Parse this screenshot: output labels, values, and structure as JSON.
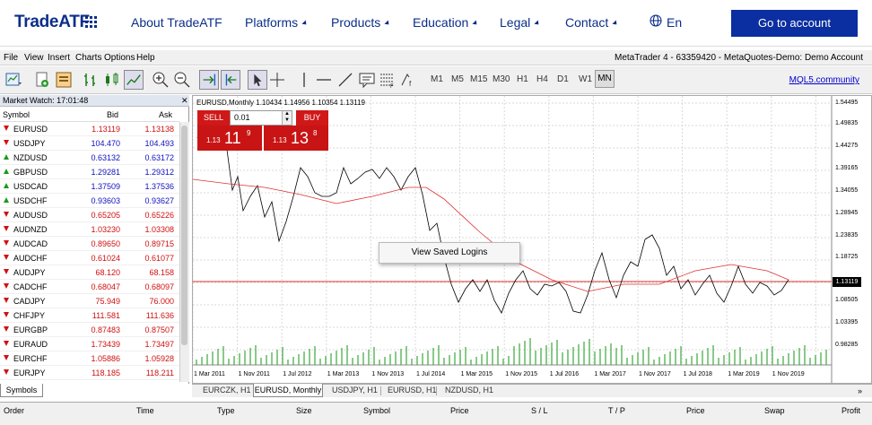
{
  "nav": {
    "logo": "TradeATF",
    "items": [
      {
        "label": "About TradeATF",
        "caret": false
      },
      {
        "label": "Platforms",
        "caret": true
      },
      {
        "label": "Products",
        "caret": true
      },
      {
        "label": "Education",
        "caret": true
      },
      {
        "label": "Legal",
        "caret": true
      },
      {
        "label": "Contact",
        "caret": true
      }
    ],
    "lang": "En",
    "cta": "Go to account"
  },
  "menubar": {
    "items": [
      "File",
      "View",
      "Insert",
      "Charts",
      "Options",
      "Help"
    ],
    "title": "MetaTrader 4 - 63359420 - MetaQuotes-Demo: Demo Account"
  },
  "toolbar": {
    "timeframes": [
      "M1",
      "M5",
      "M15",
      "M30",
      "H1",
      "H4",
      "D1",
      "W1",
      "MN"
    ],
    "community_link": "MQL5.community"
  },
  "market_watch": {
    "title": "Market Watch: 17:01:48",
    "columns": [
      "Symbol",
      "Bid",
      "Ask"
    ],
    "rows": [
      {
        "symbol": "EURUSD",
        "bid": "1.13119",
        "ask": "1.13138",
        "dir": "down",
        "color": "red"
      },
      {
        "symbol": "USDJPY",
        "bid": "104.470",
        "ask": "104.493",
        "dir": "down",
        "color": "blue"
      },
      {
        "symbol": "NZDUSD",
        "bid": "0.63132",
        "ask": "0.63172",
        "dir": "up",
        "color": "blue"
      },
      {
        "symbol": "GBPUSD",
        "bid": "1.29281",
        "ask": "1.29312",
        "dir": "up",
        "color": "blue"
      },
      {
        "symbol": "USDCAD",
        "bid": "1.37509",
        "ask": "1.37536",
        "dir": "up",
        "color": "blue"
      },
      {
        "symbol": "USDCHF",
        "bid": "0.93603",
        "ask": "0.93627",
        "dir": "up",
        "color": "blue"
      },
      {
        "symbol": "AUDUSD",
        "bid": "0.65205",
        "ask": "0.65226",
        "dir": "down",
        "color": "red"
      },
      {
        "symbol": "AUDNZD",
        "bid": "1.03230",
        "ask": "1.03308",
        "dir": "down",
        "color": "red"
      },
      {
        "symbol": "AUDCAD",
        "bid": "0.89650",
        "ask": "0.89715",
        "dir": "down",
        "color": "red"
      },
      {
        "symbol": "AUDCHF",
        "bid": "0.61024",
        "ask": "0.61077",
        "dir": "down",
        "color": "red"
      },
      {
        "symbol": "AUDJPY",
        "bid": "68.120",
        "ask": "68.158",
        "dir": "down",
        "color": "red"
      },
      {
        "symbol": "CADCHF",
        "bid": "0.68047",
        "ask": "0.68097",
        "dir": "down",
        "color": "red"
      },
      {
        "symbol": "CADJPY",
        "bid": "75.949",
        "ask": "76.000",
        "dir": "down",
        "color": "red"
      },
      {
        "symbol": "CHFJPY",
        "bid": "111.581",
        "ask": "111.636",
        "dir": "down",
        "color": "red"
      },
      {
        "symbol": "EURGBP",
        "bid": "0.87483",
        "ask": "0.87507",
        "dir": "down",
        "color": "red"
      },
      {
        "symbol": "EURAUD",
        "bid": "1.73439",
        "ask": "1.73497",
        "dir": "down",
        "color": "red"
      },
      {
        "symbol": "EURCHF",
        "bid": "1.05886",
        "ask": "1.05928",
        "dir": "down",
        "color": "red"
      },
      {
        "symbol": "EURJPY",
        "bid": "118.185",
        "ask": "118.211",
        "dir": "down",
        "color": "red"
      }
    ],
    "tab": "Symbols"
  },
  "chart": {
    "info": "EURUSD,Monthly  1.10434 1.14956 1.10354 1.13119",
    "sell_label": "SELL",
    "buy_label": "BUY",
    "lot": "0.01",
    "sell_price": {
      "a": "1.13",
      "b": "11",
      "c": "9"
    },
    "buy_price": {
      "a": "1.13",
      "b": "13",
      "c": "8"
    },
    "popup": "View Saved Logins",
    "current_price_label": "1.13119",
    "y_ticks": [
      "1.54495",
      "1.49835",
      "1.44275",
      "1.39165",
      "1.34055",
      "1.28945",
      "1.23835",
      "1.18725",
      "1.13119",
      "1.08505",
      "1.03395",
      "0.98285"
    ],
    "x_ticks": [
      "1 Mar 2011",
      "1 Nov 2011",
      "1 Jul 2012",
      "1 Mar 2013",
      "1 Nov 2013",
      "1 Jul 2014",
      "1 Mar 2015",
      "1 Nov 2015",
      "1 Jul 2016",
      "1 Mar 2017",
      "1 Nov 2017",
      "1 Jul 2018",
      "1 Mar 2019",
      "1 Nov 2019"
    ],
    "colors": {
      "price_line": "#000000",
      "ma_line": "#e03030",
      "volume": "#3aa83a",
      "level_line": "#e03030"
    }
  },
  "chart_tabs": {
    "items": [
      "EURCZK, H1",
      "EURUSD, Monthly",
      "USDJPY, H1",
      "EURUSD, H1",
      "NZDUSD, H1"
    ],
    "active_index": 1
  },
  "terminal": {
    "columns": [
      "Order",
      "Time",
      "Type",
      "Size",
      "Symbol",
      "Price",
      "S / L",
      "T / P",
      "Price",
      "Swap",
      "Profit"
    ]
  }
}
